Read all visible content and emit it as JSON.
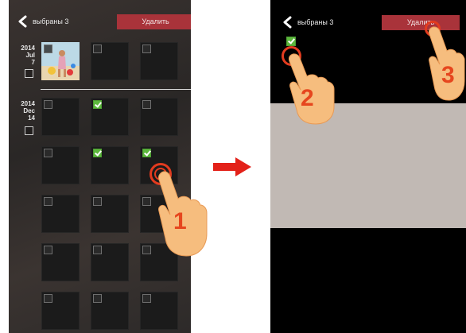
{
  "left_screen": {
    "header": {
      "selected_label": "выбраны 3",
      "delete_label": "Удалить"
    },
    "groups": [
      {
        "year": "2014",
        "month": "Jul",
        "day": "7"
      },
      {
        "year": "2014",
        "month": "Dec",
        "day": "14"
      }
    ],
    "tiles_checked": {
      "g2_r1_c2": true,
      "g2_r2_c2": true,
      "g2_r2_c3": true
    }
  },
  "right_screen": {
    "header": {
      "selected_label": "выбраны 3",
      "delete_label": "Удалить"
    }
  },
  "steps": [
    "1",
    "2",
    "3"
  ],
  "colors": {
    "accent_red": "#a9333a",
    "check_green": "#5cb83d",
    "arrow_red": "#e32119",
    "step_orange": "#e6461e"
  }
}
